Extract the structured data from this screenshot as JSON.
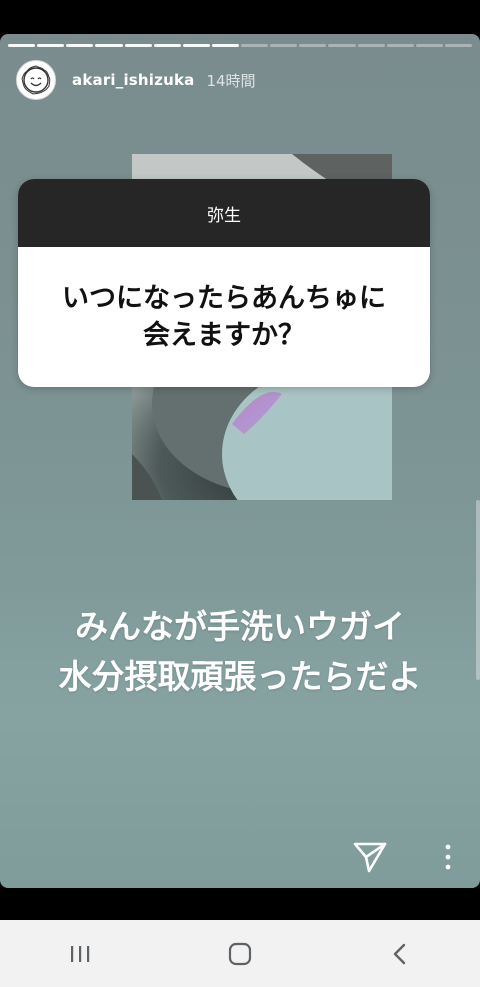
{
  "story": {
    "progress": {
      "total_segments": 16,
      "completed_segments": 8
    },
    "header": {
      "username": "akari_ishizuka",
      "time_ago": "14時間"
    },
    "question_sticker": {
      "asker": "弥生",
      "question": "いつになったらあんちゅに会えますか？"
    },
    "caption": {
      "line1": "みんなが手洗いウガイ",
      "line2": "水分摂取頑張ったらだよ"
    },
    "actions": {
      "send_icon": "paper-plane-icon",
      "more_icon": "vertical-dots-icon"
    }
  },
  "system_nav": {
    "recents_icon": "recents-icon",
    "home_icon": "home-icon",
    "back_icon": "back-icon"
  },
  "colors": {
    "background": "#000000",
    "story_bg": "#7f9898",
    "sticker_header": "#262626",
    "navbar": "#f2f2f2"
  }
}
